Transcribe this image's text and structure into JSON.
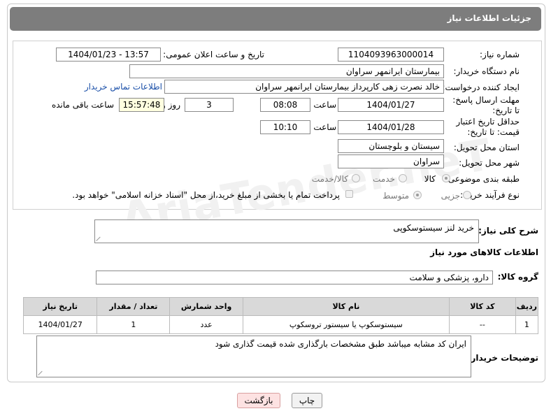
{
  "header": {
    "title": "جزئیات اطلاعات نیاز"
  },
  "form": {
    "need_number_label": "شماره نیاز:",
    "need_number": "1104093963000014",
    "announce_label": "تاریخ و ساعت اعلان عمومی:",
    "announce_value": "1404/01/23 - 13:57",
    "buyer_org_label": "نام دستگاه خریدار:",
    "buyer_org": "بیمارستان ایرانمهر سراوان",
    "creator_label": "ایجاد کننده درخواست:",
    "creator": "خالد نصرت زهی کارپرداز بیمارستان ایرانمهر سراوان",
    "contact_link": "اطلاعات تماس خریدار",
    "reply_deadline_label": "مهلت ارسال پاسخ: تا تاریخ:",
    "reply_date": "1404/01/27",
    "time_label": "ساعت",
    "reply_time": "08:08",
    "days_value": "3",
    "days_label": "روز و",
    "remaining_time": "15:57:48",
    "remaining_label": "ساعت باقی مانده",
    "price_validity_label": "حداقل تاریخ اعتبار قیمت: تا تاریخ:",
    "price_date": "1404/01/28",
    "price_time_label": "ساعت",
    "price_time": "10:10",
    "province_label": "استان محل تحویل:",
    "province": "سیستان و بلوچستان",
    "city_label": "شهر محل تحویل:",
    "city": "سراوان",
    "category_label": "طبقه بندی موضوعی:",
    "cat_goods": "کالا",
    "cat_service": "خدمت",
    "cat_both": "کالا/خدمت",
    "process_label": "نوع فرآیند خرید :",
    "proc_partial": "جزیی",
    "proc_medium": "متوسط",
    "payment_note": "پرداخت تمام یا بخشی از مبلغ خرید،از محل \"اسناد خزانه اسلامی\" خواهد بود."
  },
  "summary": {
    "label": "شرح کلی نیاز:",
    "value": "خرید لنز سیستوسکوپی"
  },
  "goods": {
    "section_title": "اطلاعات کالاهای مورد نیاز",
    "group_label": "گروه کالا:",
    "group_value": "دارو، پزشکی و سلامت",
    "columns": [
      "ردیف",
      "کد کالا",
      "نام کالا",
      "واحد شمارش",
      "تعداد / مقدار",
      "تاریخ نیاز"
    ],
    "rows": [
      [
        "1",
        "--",
        "سیستوسکوپ یا سیستور تروسکوپ",
        "عدد",
        "1",
        "1404/01/27"
      ]
    ]
  },
  "notes": {
    "label": "توضیحات خریدار:",
    "value": "ایران کد مشابه میباشد طبق مشخصات بارگذاری شده قیمت گذاری شود"
  },
  "buttons": {
    "print": "چاپ",
    "back": "بازگشت"
  },
  "watermark": "AriaTender.neT",
  "colors": {
    "titlebar": "#7d7d7d",
    "link": "#1a4fa8",
    "back_button": "#fde2e2"
  }
}
